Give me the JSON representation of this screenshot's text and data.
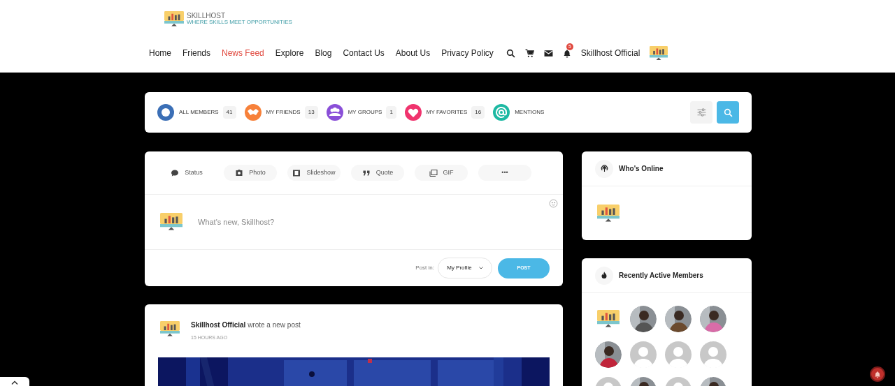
{
  "logo": {
    "name": "SKILLHOST",
    "tagline": "WHERE SKILLS MEET OPPORTUNITIES"
  },
  "nav": [
    {
      "label": "Home",
      "selected": false
    },
    {
      "label": "Friends",
      "selected": false
    },
    {
      "label": "News Feed",
      "selected": true
    },
    {
      "label": "Explore",
      "selected": false
    },
    {
      "label": "Blog",
      "selected": false
    },
    {
      "label": "Contact Us",
      "selected": false
    },
    {
      "label": "About Us",
      "selected": false
    },
    {
      "label": "Privacy Policy",
      "selected": false
    }
  ],
  "notifications_badge": "5",
  "user_name": "Skillhost Official",
  "member_filters": [
    {
      "label": "ALL MEMBERS",
      "count": "41",
      "color": "#3b6fb6"
    },
    {
      "label": "MY FRIENDS",
      "count": "13",
      "color": "#f7813a"
    },
    {
      "label": "MY GROUPS",
      "count": "1",
      "color": "#8a4fd8"
    },
    {
      "label": "MY FAVORITES",
      "count": "16",
      "color": "#f0346e"
    },
    {
      "label": "MENTIONS",
      "color": "#1db9a3"
    }
  ],
  "composer": {
    "post_types": [
      {
        "kind": "status",
        "label": "Status"
      },
      {
        "label": "Photo"
      },
      {
        "kind": "slideshow",
        "label": "Slideshow"
      },
      {
        "kind": "quote",
        "label": "Quote"
      },
      {
        "kind": "gif",
        "label": "GIF"
      },
      {
        "kind": "more",
        "label": "•••"
      }
    ],
    "placeholder": "What's new, Skillhost?",
    "post_in_label": "Post in:",
    "post_in_value": "My Profile",
    "post_button": "POST"
  },
  "activity": {
    "author": "Skillhost Official",
    "action": "wrote a new post",
    "time": "15 HOURS AGO"
  },
  "whos_online": {
    "title": "Who's Online"
  },
  "recently_active": {
    "title": "Recently Active Members",
    "members": [
      {
        "kind": "logo"
      },
      {
        "kind": "picture"
      },
      {
        "kind": "picture"
      },
      {
        "kind": "picture"
      },
      {
        "kind": "picture"
      },
      {
        "kind": "default"
      },
      {
        "kind": "default"
      },
      {
        "kind": "default"
      },
      {
        "kind": "default"
      },
      {
        "kind": "picture"
      },
      {
        "kind": "default"
      },
      {
        "kind": "picture"
      }
    ]
  }
}
